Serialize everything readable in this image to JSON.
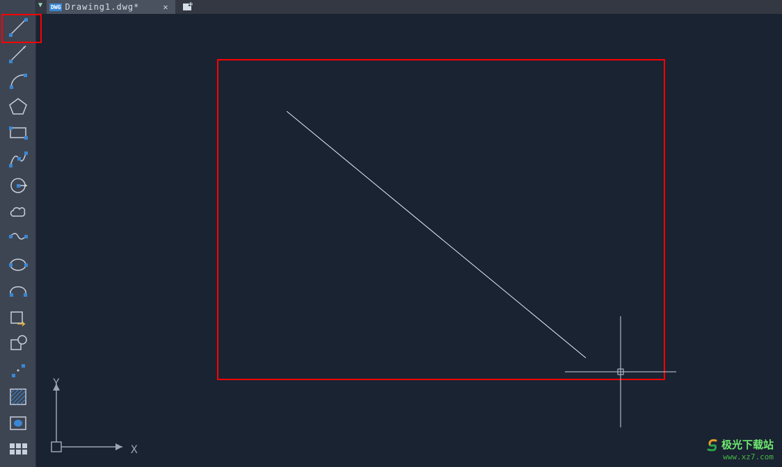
{
  "tab": {
    "label": "Drawing1.dwg*",
    "icon_text": "DWG"
  },
  "tools": [
    {
      "name": "line",
      "label": "line-tool"
    },
    {
      "name": "construction-line",
      "label": "construction-line-tool"
    },
    {
      "name": "arc",
      "label": "arc-tool"
    },
    {
      "name": "polygon",
      "label": "polygon-tool"
    },
    {
      "name": "rectangle",
      "label": "rectangle-tool"
    },
    {
      "name": "spline",
      "label": "spline-tool"
    },
    {
      "name": "break-circle",
      "label": "break-circle-tool"
    },
    {
      "name": "revision-cloud",
      "label": "revision-cloud-tool"
    },
    {
      "name": "helix",
      "label": "helix-tool"
    },
    {
      "name": "ellipse",
      "label": "ellipse-tool"
    },
    {
      "name": "ellipse-arc",
      "label": "ellipse-arc-tool"
    },
    {
      "name": "insert-block",
      "label": "insert-block-tool"
    },
    {
      "name": "make-block",
      "label": "make-block-tool"
    },
    {
      "name": "point",
      "label": "point-tool"
    },
    {
      "name": "hatch",
      "label": "hatch-tool"
    },
    {
      "name": "donut",
      "label": "donut-tool"
    },
    {
      "name": "grid",
      "label": "grid-tool"
    }
  ],
  "axis": {
    "x": "X",
    "y": "Y"
  },
  "watermark": {
    "title": "极光下载站",
    "url": "www.xz7.com"
  },
  "colors": {
    "background": "#1a2332",
    "toolbar": "#3e4552",
    "highlight": "#ff0000",
    "grip": "#3a87d4",
    "stroke": "#c8d0dc"
  }
}
